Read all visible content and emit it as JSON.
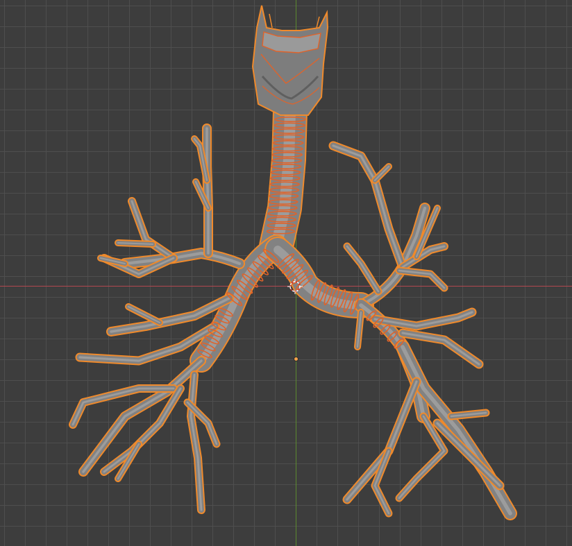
{
  "viewport": {
    "background_color": "#3d3d3d",
    "grid_color": "#505050",
    "x_axis_color": "#b3474f",
    "y_axis_color": "#5c8a2f",
    "selection_outline_color": "#f08a2b",
    "mesh_color": "#828282"
  },
  "scene": {
    "object": "bronchial-tree-mesh",
    "selected": true,
    "cursor_icon": "3d-cursor-icon",
    "origin_icon": "object-origin-icon"
  }
}
